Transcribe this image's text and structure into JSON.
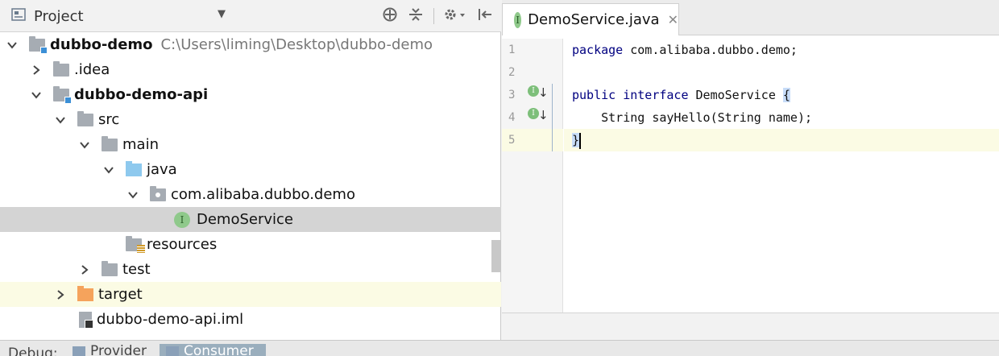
{
  "project_panel": {
    "title": "Project",
    "tree": [
      {
        "label": "dubbo-demo",
        "hint": "C:\\Users\\liming\\Desktop\\dubbo-demo"
      },
      {
        "label": ".idea"
      },
      {
        "label": "dubbo-demo-api"
      },
      {
        "label": "src"
      },
      {
        "label": "main"
      },
      {
        "label": "java"
      },
      {
        "label": "com.alibaba.dubbo.demo"
      },
      {
        "label": "DemoService"
      },
      {
        "label": "resources"
      },
      {
        "label": "test"
      },
      {
        "label": "target"
      },
      {
        "label": "dubbo-demo-api.iml"
      }
    ]
  },
  "editor": {
    "tab_label": "DemoService.java",
    "interface_badge": "I",
    "line_numbers": [
      "1",
      "2",
      "3",
      "4",
      "5"
    ],
    "code": {
      "l1_kw": "package",
      "l1_rest": " com.alibaba.dubbo.demo;",
      "l3_kw": "public interface",
      "l3_rest": " DemoService ",
      "l3_brace": "{",
      "l4": "    String sayHello(String name);",
      "l5_brace": "}"
    }
  },
  "bottom_bar": {
    "debug_label": "Debug:",
    "tabs": [
      "Provider",
      "Consumer"
    ]
  },
  "colors": {
    "keyword": "#000080",
    "interface_icon": "#8fc98b",
    "current_line": "#fbfbe4",
    "selected_row": "#d4d4d4"
  }
}
